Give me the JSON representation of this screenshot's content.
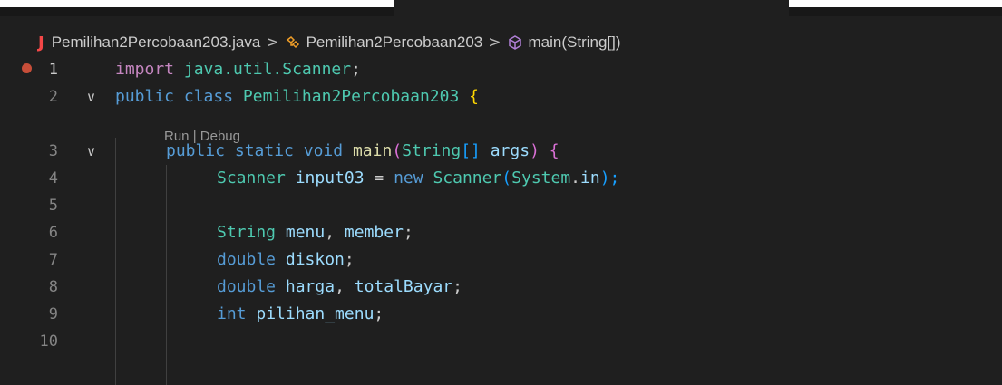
{
  "breadcrumb": {
    "file_icon": "J",
    "file": "Pemilihan2Percobaan203.java",
    "class": "Pemilihan2Percobaan203",
    "method": "main(String[])",
    "separator": ">"
  },
  "codelens": {
    "run": "Run",
    "divider": "|",
    "debug": "Debug"
  },
  "lines": [
    {
      "num": "1",
      "t": [
        "import",
        " java.util.Scanner",
        ";"
      ]
    },
    {
      "num": "2",
      "t": [
        "public",
        " ",
        "class",
        " ",
        "Pemilihan2Percobaan203",
        " ",
        "{"
      ]
    },
    {
      "num": "3",
      "t": [
        "public",
        " ",
        "static",
        " ",
        "void",
        " ",
        "main",
        "(",
        "String",
        "[]",
        " ",
        "args",
        ")",
        " ",
        "{"
      ]
    },
    {
      "num": "4",
      "t": [
        "Scanner",
        " ",
        "input03",
        " = ",
        "new",
        " ",
        "Scanner",
        "(",
        "System",
        ".",
        "in",
        ");"
      ]
    },
    {
      "num": "5",
      "t": []
    },
    {
      "num": "6",
      "t": [
        "String",
        " ",
        "menu",
        ", ",
        "member",
        ";"
      ]
    },
    {
      "num": "7",
      "t": [
        "double",
        " ",
        "diskon",
        ";"
      ]
    },
    {
      "num": "8",
      "t": [
        "double",
        " ",
        "harga",
        ", ",
        "totalBayar",
        ";"
      ]
    },
    {
      "num": "9",
      "t": [
        "int",
        " ",
        "pilihan_menu",
        ";"
      ]
    },
    {
      "num": "10",
      "t": []
    }
  ],
  "icons": {
    "fold": "chevron-down-icon",
    "breakpoint": "breakpoint-icon",
    "class": "class-icon",
    "method": "method-icon",
    "java": "java-file-icon"
  },
  "colors": {
    "keyword": "#569cd6",
    "type": "#4ec9b0",
    "function": "#dcdcaa",
    "variable": "#9cdcfe",
    "bracket1": "#ffd700",
    "bracket2": "#da70d6",
    "bracket3": "#179fff",
    "breakpoint": "#c74e39"
  }
}
